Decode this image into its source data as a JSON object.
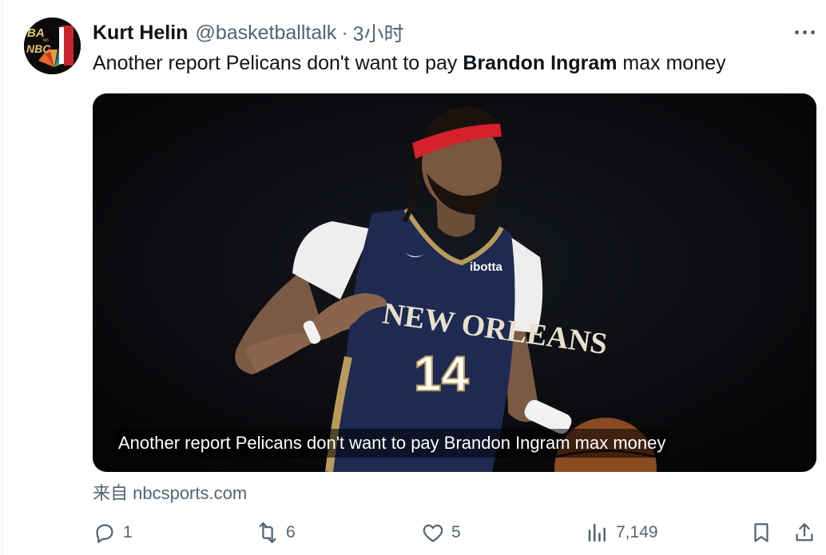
{
  "tweet": {
    "author_name": "Kurt Helin",
    "handle": "@basketballtalk",
    "separator": "·",
    "time": "3小时",
    "text_prefix": "Another report Pelicans don't want to pay ",
    "text_bold": "Brandon Ingram",
    "text_suffix": " max money",
    "avatar_text_top": "BA",
    "avatar_text_bottom": "NBC",
    "avatar_small": "on"
  },
  "card": {
    "caption": "Another report Pelicans don't want to pay Brandon Ingram max money",
    "jersey_team": "NEW ORLEANS",
    "jersey_number": "14",
    "jersey_sponsor": "ibotta",
    "source": "来自 nbcsports.com"
  },
  "actions": {
    "reply_count": "1",
    "retweet_count": "6",
    "like_count": "5",
    "views_count": "7,149"
  },
  "icons": [
    "more-icon",
    "reply-icon",
    "retweet-icon",
    "like-icon",
    "views-icon",
    "bookmark-icon",
    "share-icon"
  ],
  "colors": {
    "text": "#0f1419",
    "secondary": "#536471",
    "jersey_navy": "#1e2a52",
    "headband_red": "#d6202c",
    "jersey_gold": "#b89a5a"
  }
}
